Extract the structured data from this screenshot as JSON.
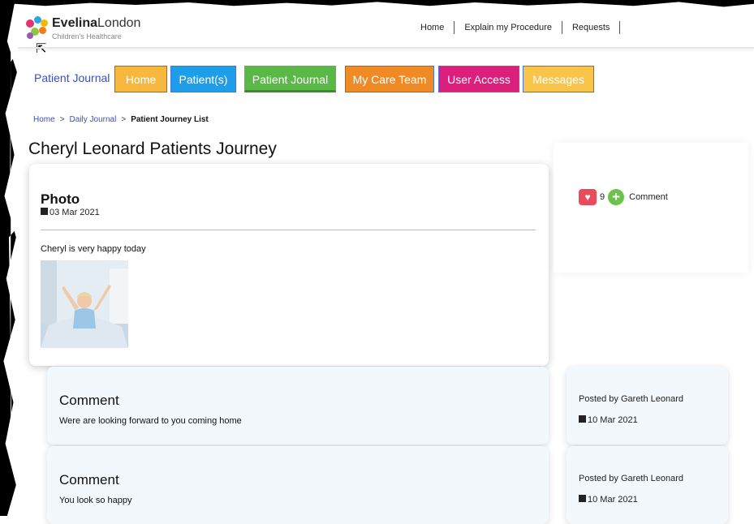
{
  "brand": {
    "name_bold": "Evelina",
    "name_rest": "London",
    "subtitle": "Children's Healthcare"
  },
  "top_nav": [
    "Home",
    "Explain my Procedure",
    "Requests"
  ],
  "main_nav": {
    "title": "Patient Journal",
    "tabs": [
      "Home",
      "Patient(s)",
      "Patient Journal",
      "My Care Team",
      "User Access",
      "Messages"
    ]
  },
  "breadcrumb": {
    "items": [
      "Home",
      "Daily Journal"
    ],
    "separator": ">",
    "current": "Patient Journey List"
  },
  "page_title": "Cheryl Leonard Patients Journey",
  "post": {
    "title": "Photo",
    "date": "03 Mar 2021",
    "text": "Cheryl is very happy today",
    "likes": "9",
    "comment_label": "Comment"
  },
  "comments": [
    {
      "title": "Comment",
      "text": "Were are looking forward to you coming home",
      "posted_by": "Posted by Gareth Leonard",
      "date": "10 Mar 2021"
    },
    {
      "title": "Comment",
      "text": "You look so happy",
      "posted_by": "Posted by Gareth Leonard",
      "date": "10 Mar 2021"
    }
  ],
  "colors": {
    "tab_home": "#f8b73d",
    "tab_patients": "#1e9ee8",
    "tab_journal": "#5ab846",
    "tab_care_team": "#f08a24",
    "tab_user_access": "#dc1e7c",
    "tab_messages": "#f8c44a",
    "link": "#3a50b8",
    "comment_bg": "#f2f8fc"
  }
}
